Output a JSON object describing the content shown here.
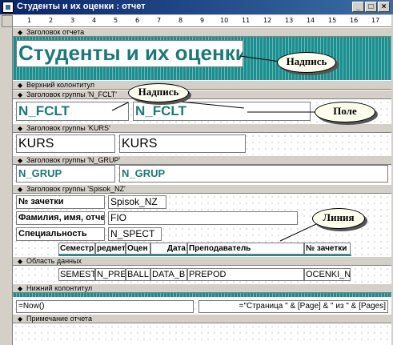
{
  "window": {
    "title": "Студенты и их оценки : отчет",
    "buttons": [
      "_",
      "□",
      "×"
    ]
  },
  "ruler": {
    "marks": [
      "1",
      "2",
      "3",
      "4",
      "5",
      "6",
      "7",
      "8",
      "9",
      "10",
      "11",
      "12",
      "13",
      "14",
      "15",
      "16",
      "17"
    ]
  },
  "sections": {
    "report_header": "Заголовок отчета",
    "page_header": "Верхний колонтитул",
    "group_fclt": "Заголовок группы 'N_FCLT'",
    "group_kurs": "Заголовок группы 'KURS'",
    "group_grup": "Заголовок группы 'N_GRUP'",
    "group_spisok": "Заголовок группы 'Spisok_NZ'",
    "detail": "Область данных",
    "page_footer": "Нижний колонтитул",
    "report_footer": "Примечание отчета"
  },
  "report_title": "Студенты и их оценки",
  "fclt": {
    "label": "N_FCLT",
    "field": "N_FCLT"
  },
  "kurs": {
    "label": "KURS",
    "field": "KURS"
  },
  "grup": {
    "label": "N_GRUP",
    "field": "N_GRUP"
  },
  "spisok": {
    "nz_label": "№ зачетки",
    "nz_field": "Spisok_NZ",
    "fio_label": "Фамилия, имя, отчес",
    "fio_field": "FIO",
    "spec_label": "Специальность",
    "spec_field": "N_SPECT"
  },
  "columns": {
    "headers": [
      "Семестр",
      "редмет",
      "Оцен",
      "Дата",
      "Преподаватель",
      "№ зачетки"
    ],
    "fields": [
      "SEMEST",
      "N_PRE",
      "BALL",
      "DATA_B",
      "PREPOD",
      "OCENKI_NZ"
    ]
  },
  "footer": {
    "now": "=Now()",
    "page": "=\"Страница \" & [Page] & \" из \" & [Pages]"
  },
  "callouts": {
    "nadpis1": "Надпись",
    "nadpis2": "Надпись",
    "pole": "Поле",
    "linia": "Линия"
  }
}
